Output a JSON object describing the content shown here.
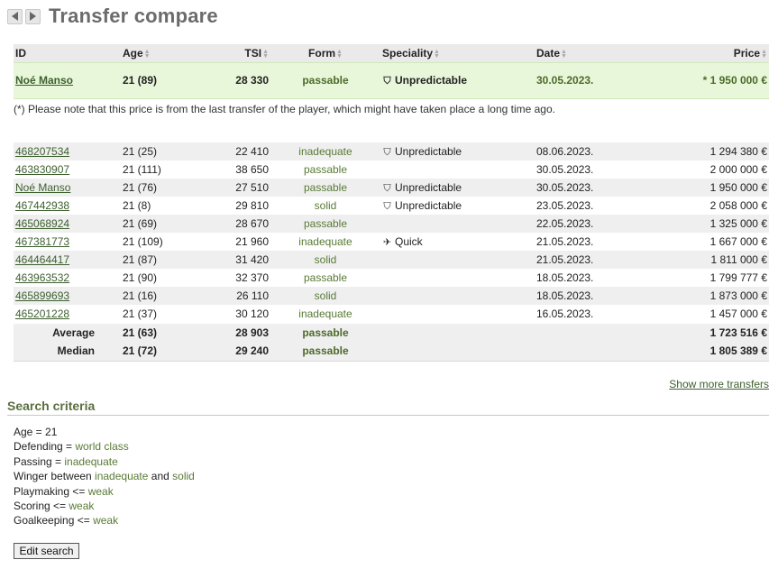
{
  "page": {
    "title": "Transfer compare"
  },
  "columns": {
    "id": "ID",
    "age": "Age",
    "tsi": "TSI",
    "form": "Form",
    "speciality": "Speciality",
    "date": "Date",
    "price": "Price"
  },
  "player": {
    "id": "Noé Manso",
    "age": "21 (89)",
    "tsi": "28 330",
    "form": "passable",
    "speciality": "Unpredictable",
    "speciality_icon": "umbrella-icon",
    "date": "30.05.2023.",
    "price": "* 1 950 000 €"
  },
  "note": "(*) Please note that this price is from the last transfer of the player, which might have taken place a long time ago.",
  "transfers": [
    {
      "id": "468207534",
      "age": "21 (25)",
      "tsi": "22 410",
      "form": "inadequate",
      "speciality": "Unpredictable",
      "speciality_icon": "umbrella-icon",
      "date": "08.06.2023.",
      "price": "1 294 380 €"
    },
    {
      "id": "463830907",
      "age": "21 (111)",
      "tsi": "38 650",
      "form": "passable",
      "speciality": "",
      "speciality_icon": "",
      "date": "30.05.2023.",
      "price": "2 000 000 €"
    },
    {
      "id": "Noé Manso",
      "age": "21 (76)",
      "tsi": "27 510",
      "form": "passable",
      "speciality": "Unpredictable",
      "speciality_icon": "umbrella-icon",
      "date": "30.05.2023.",
      "price": "1 950 000 €"
    },
    {
      "id": "467442938",
      "age": "21 (8)",
      "tsi": "29 810",
      "form": "solid",
      "speciality": "Unpredictable",
      "speciality_icon": "umbrella-icon",
      "date": "23.05.2023.",
      "price": "2 058 000 €"
    },
    {
      "id": "465068924",
      "age": "21 (69)",
      "tsi": "28 670",
      "form": "passable",
      "speciality": "",
      "speciality_icon": "",
      "date": "22.05.2023.",
      "price": "1 325 000 €"
    },
    {
      "id": "467381773",
      "age": "21 (109)",
      "tsi": "21 960",
      "form": "inadequate",
      "speciality": "Quick",
      "speciality_icon": "running-icon",
      "date": "21.05.2023.",
      "price": "1 667 000 €"
    },
    {
      "id": "464464417",
      "age": "21 (87)",
      "tsi": "31 420",
      "form": "solid",
      "speciality": "",
      "speciality_icon": "",
      "date": "21.05.2023.",
      "price": "1 811 000 €"
    },
    {
      "id": "463963532",
      "age": "21 (90)",
      "tsi": "32 370",
      "form": "passable",
      "speciality": "",
      "speciality_icon": "",
      "date": "18.05.2023.",
      "price": "1 799 777 €"
    },
    {
      "id": "465899693",
      "age": "21 (16)",
      "tsi": "26 110",
      "form": "solid",
      "speciality": "",
      "speciality_icon": "",
      "date": "18.05.2023.",
      "price": "1 873 000 €"
    },
    {
      "id": "465201228",
      "age": "21 (37)",
      "tsi": "30 120",
      "form": "inadequate",
      "speciality": "",
      "speciality_icon": "",
      "date": "16.05.2023.",
      "price": "1 457 000 €"
    }
  ],
  "summary": {
    "average": {
      "label": "Average",
      "age": "21 (63)",
      "tsi": "28 903",
      "form": "passable",
      "price": "1 723 516 €"
    },
    "median": {
      "label": "Median",
      "age": "21 (72)",
      "tsi": "29 240",
      "form": "passable",
      "price": "1 805 389 €"
    }
  },
  "show_more": "Show more transfers",
  "criteria": {
    "title": "Search criteria",
    "age": {
      "label": "Age = ",
      "value": "21"
    },
    "defending": {
      "label": "Defending = ",
      "value": "world class"
    },
    "passing": {
      "label": "Passing = ",
      "value": "inadequate"
    },
    "winger": {
      "label": "Winger between ",
      "value1": "inadequate",
      "mid": " and ",
      "value2": "solid"
    },
    "playmaking": {
      "label": "Playmaking <= ",
      "value": "weak"
    },
    "scoring": {
      "label": "Scoring <= ",
      "value": "weak"
    },
    "goalkeeping": {
      "label": "Goalkeeping <= ",
      "value": "weak"
    },
    "edit_button": "Edit search"
  },
  "colors": {
    "player_row_bg": "#e8f7da",
    "link": "#3c5f2e",
    "form_text": "#5a7a35",
    "title": "#6b6b6b"
  }
}
